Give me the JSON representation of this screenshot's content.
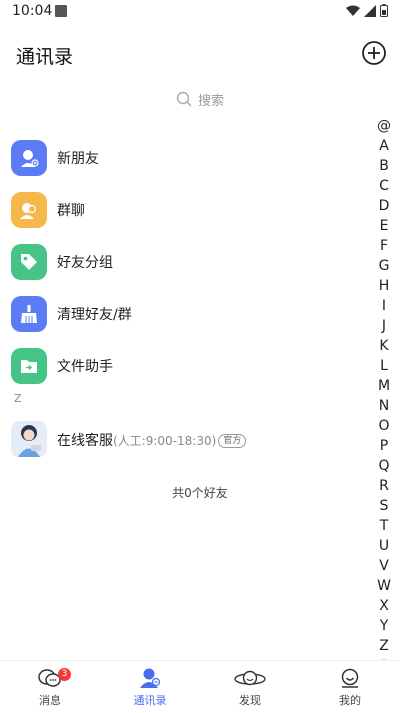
{
  "status_bar": {
    "time": "10:04"
  },
  "header": {
    "title": "通讯录"
  },
  "search": {
    "placeholder": "搜索"
  },
  "entries": [
    {
      "label": "新朋友",
      "color": "#5b7cf6",
      "icon": "new-friend-icon"
    },
    {
      "label": "群聊",
      "color": "#f7b84a",
      "icon": "group-chat-icon"
    },
    {
      "label": "好友分组",
      "color": "#45c486",
      "icon": "tag-icon"
    },
    {
      "label": "清理好友/群",
      "color": "#5b7cf6",
      "icon": "broom-icon"
    },
    {
      "label": "文件助手",
      "color": "#45c486",
      "icon": "folder-icon"
    }
  ],
  "section_letter": "Z",
  "customer_service": {
    "name": "在线客服",
    "hours": "(人工:9:00-18:30)",
    "tag": "官方"
  },
  "friend_count": "共0个好友",
  "index_letters": [
    "@",
    "A",
    "B",
    "C",
    "D",
    "E",
    "F",
    "G",
    "H",
    "I",
    "J",
    "K",
    "L",
    "M",
    "N",
    "O",
    "P",
    "Q",
    "R",
    "S",
    "T",
    "U",
    "V",
    "W",
    "X",
    "Y",
    "Z"
  ],
  "tabs": [
    {
      "label": "消息",
      "icon": "message-icon",
      "badge": "3"
    },
    {
      "label": "通讯录",
      "icon": "contacts-icon",
      "active": true
    },
    {
      "label": "发现",
      "icon": "planet-icon"
    },
    {
      "label": "我的",
      "icon": "smiley-icon"
    }
  ],
  "colors": {
    "accent": "#4a6cf0",
    "badge": "#f03a3a"
  }
}
